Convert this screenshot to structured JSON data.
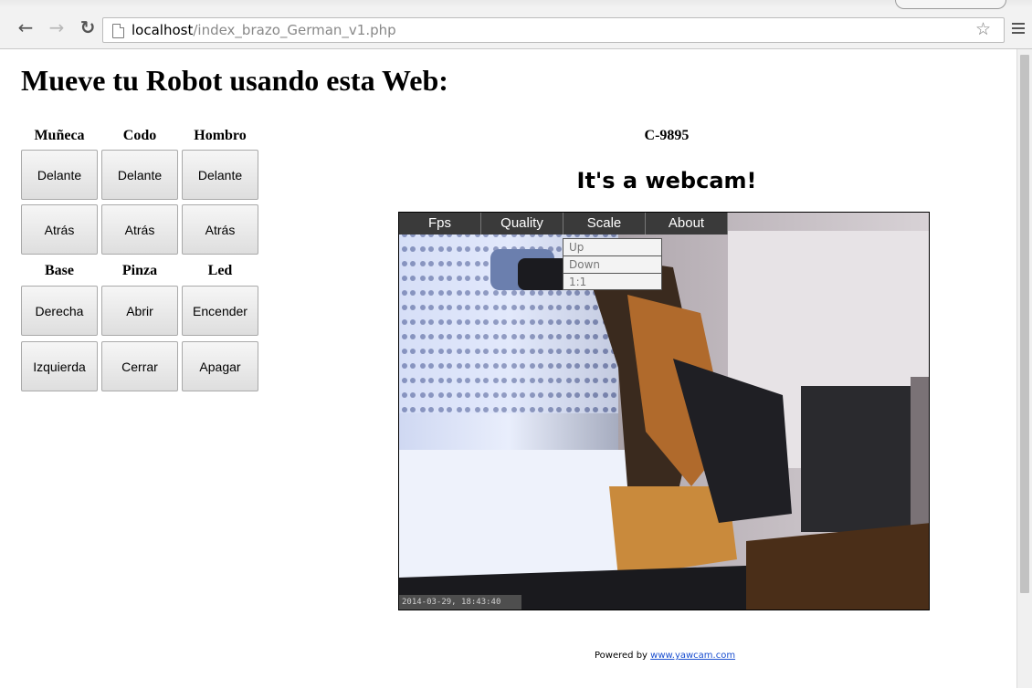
{
  "browser": {
    "url_host": "localhost",
    "url_path": "/index_brazo_German_v1.php"
  },
  "page": {
    "heading": "Mueve tu Robot usando esta Web:"
  },
  "controls": {
    "group1": {
      "labels": [
        "Muñeca",
        "Codo",
        "Hombro"
      ],
      "row1": [
        "Delante",
        "Delante",
        "Delante"
      ],
      "row2": [
        "Atrás",
        "Atrás",
        "Atrás"
      ]
    },
    "group2": {
      "labels": [
        "Base",
        "Pinza",
        "Led"
      ],
      "row1": [
        "Derecha",
        "Abrir",
        "Encender"
      ],
      "row2": [
        "Izquierda",
        "Cerrar",
        "Apagar"
      ]
    }
  },
  "webcam": {
    "id": "C-9895",
    "title": "It's a webcam!",
    "menu": [
      "Fps",
      "Quality",
      "Scale",
      "About"
    ],
    "scale_options": [
      "Up",
      "Down",
      "1:1"
    ],
    "timestamp": "2014-03-29, 18:43:40"
  },
  "footer": {
    "powered_by": "Powered by",
    "link": "www.yawcam.com"
  },
  "icons": {
    "back": "back-arrow-icon",
    "forward": "forward-arrow-icon",
    "reload": "reload-icon",
    "page": "page-icon",
    "bookmark": "star-icon",
    "menu": "hamburger-menu-icon"
  }
}
